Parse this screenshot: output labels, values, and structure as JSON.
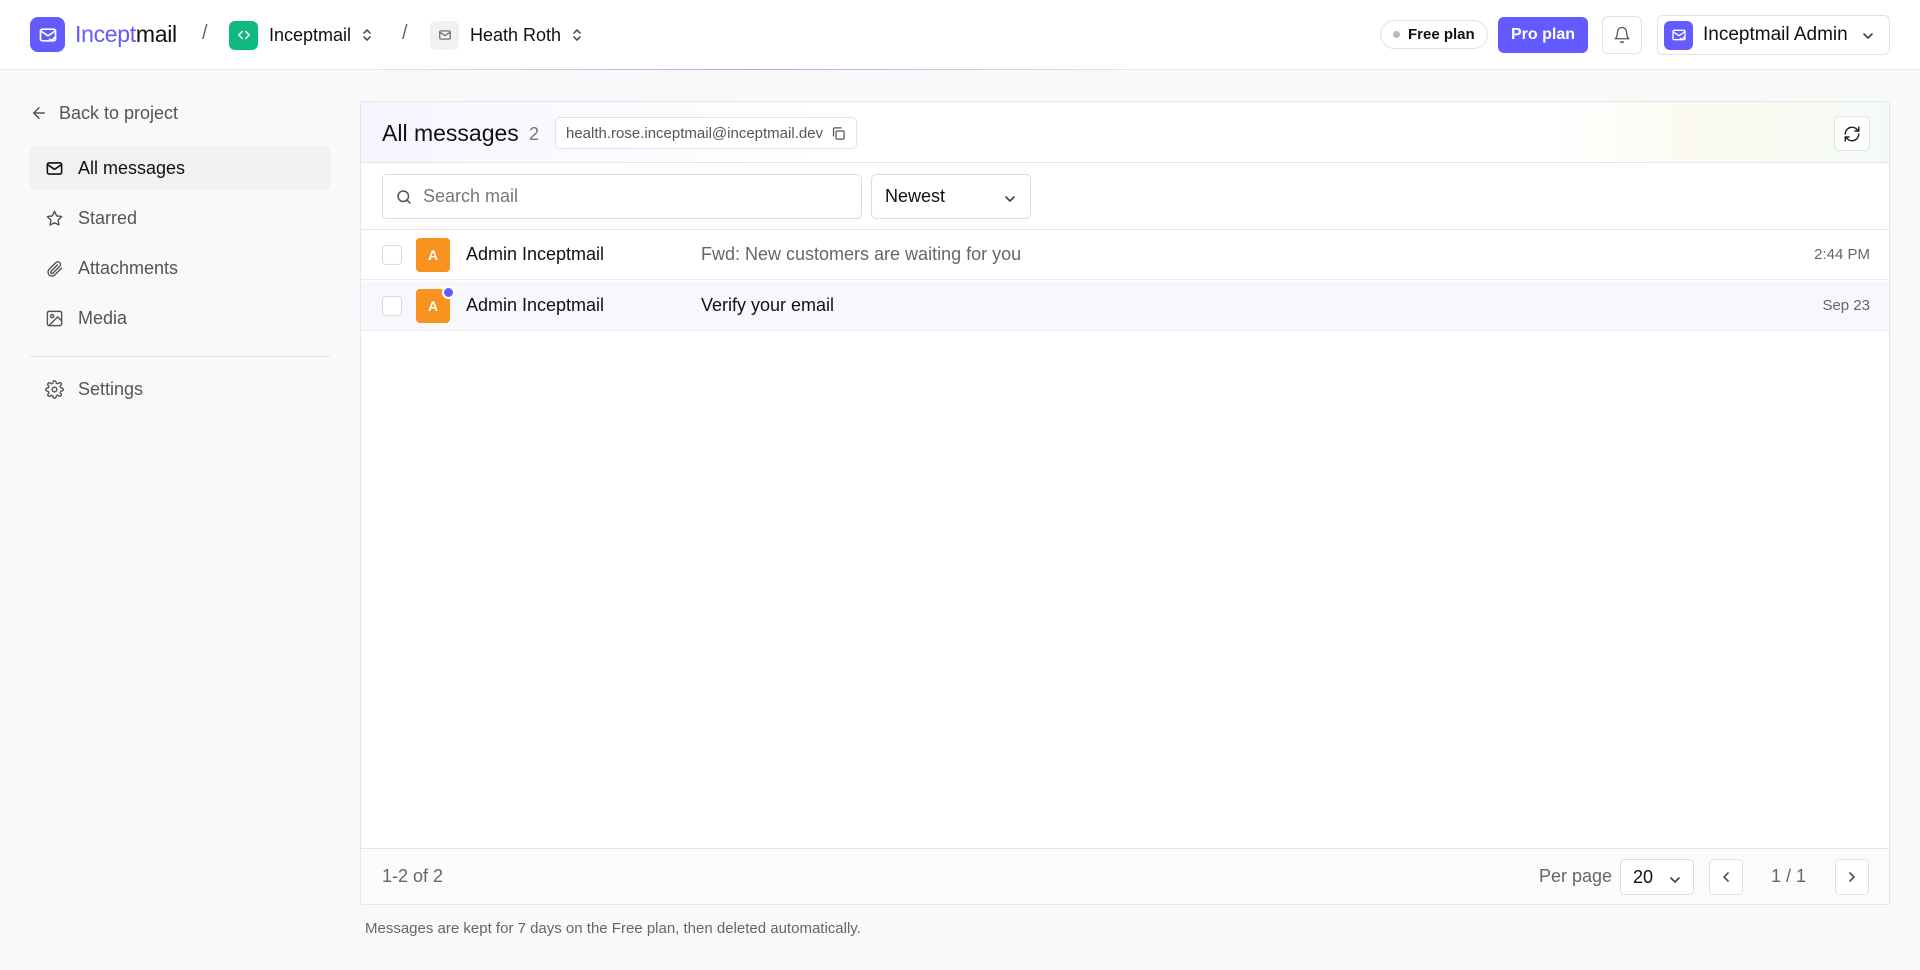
{
  "brand": {
    "part1": "Incept",
    "part2": "mail"
  },
  "breadcrumb": {
    "separator": "/",
    "project": {
      "label": "Inceptmail",
      "icon": "code-icon",
      "color": "#10b981"
    },
    "inbox": {
      "label": "Heath Roth",
      "icon": "mail-icon"
    }
  },
  "header": {
    "free_plan": "Free plan",
    "pro_plan": "Pro plan",
    "account_name": "Inceptmail Admin"
  },
  "sidebar": {
    "back": "Back to project",
    "items": [
      {
        "label": "All messages",
        "icon": "mail-icon",
        "active": true
      },
      {
        "label": "Starred",
        "icon": "star-icon",
        "active": false
      },
      {
        "label": "Attachments",
        "icon": "paperclip-icon",
        "active": false
      },
      {
        "label": "Media",
        "icon": "image-icon",
        "active": false
      }
    ],
    "settings": {
      "label": "Settings",
      "icon": "gear-icon"
    }
  },
  "main": {
    "title": "All messages",
    "count": "2",
    "email": "health.rose.inceptmail@inceptmail.dev",
    "search_placeholder": "Search mail",
    "sort": "Newest",
    "messages": [
      {
        "initial": "A",
        "sender": "Admin Inceptmail",
        "subject": "Fwd: New customers are waiting for you",
        "time": "2:44 PM",
        "unread": false
      },
      {
        "initial": "A",
        "sender": "Admin Inceptmail",
        "subject": "Verify your email",
        "time": "Sep 23",
        "unread": true
      }
    ],
    "footer": {
      "range": "1-2 of 2",
      "per_page_label": "Per page",
      "per_page": "20",
      "page": "1 / 1"
    }
  },
  "retention_note": "Messages are kept for 7 days on the Free plan, then deleted automatically.",
  "colors": {
    "accent": "#635bff",
    "avatar": "#f7931e",
    "project": "#10b981"
  }
}
